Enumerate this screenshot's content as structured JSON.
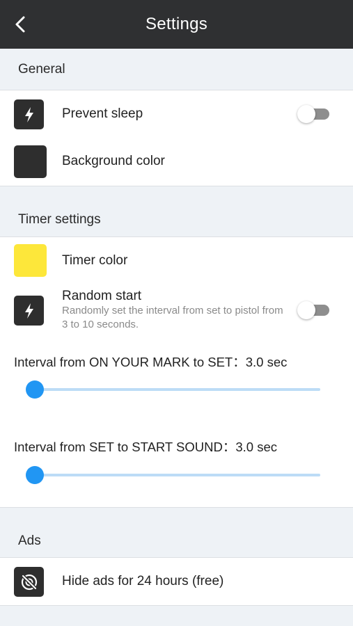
{
  "header": {
    "title": "Settings",
    "back_icon": "chevron-left-icon"
  },
  "sections": {
    "general": "General",
    "timer": "Timer settings",
    "ads": "Ads"
  },
  "general": {
    "prevent_sleep": {
      "label": "Prevent sleep",
      "icon": "lightning-icon",
      "toggle_on": false
    },
    "background_color": {
      "label": "Background color",
      "color": "#2e2e2e"
    }
  },
  "timer": {
    "timer_color": {
      "label": "Timer color",
      "color": "#fde73a"
    },
    "random_start": {
      "label": "Random start",
      "description": "Randomly set the interval from set to pistol from 3 to 10 seconds.",
      "icon": "lightning-icon",
      "toggle_on": false
    },
    "interval_mark_set": {
      "label": "Interval from ON YOUR MARK to SET：3.0 sec",
      "value_sec": 3.0,
      "min_sec": 3,
      "max_sec": 10
    },
    "interval_set_start": {
      "label": "Interval from SET to START SOUND：3.0 sec",
      "value_sec": 3.0,
      "min_sec": 3,
      "max_sec": 10
    }
  },
  "ads": {
    "hide_ads": {
      "label": "Hide ads for 24 hours (free)",
      "icon": "no-ads-icon"
    }
  },
  "colors": {
    "navbar": "#2f3032",
    "accent": "#2196f3",
    "page_background": "#eef2f6"
  }
}
